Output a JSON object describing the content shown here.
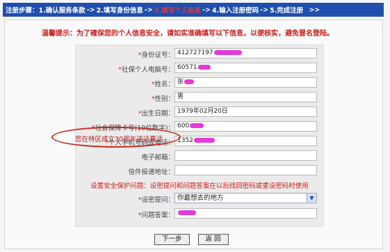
{
  "steps": {
    "intro": "注册步骤：",
    "s1": "1.确认服务条款",
    "s2": "2.填写身份信息",
    "s3": "3.填写个人信息",
    "s4": "4.输入注册密码",
    "s5": "5.完成注册",
    "arrow": "->",
    "tail": ">>"
  },
  "warning": "温馨提示：为了確保您的个人信息安全，请如实准确填写以下信息，以便核实，避免冒名登陆。",
  "form": {
    "fields": [
      {
        "label": "身份证号：",
        "value": "412727197"
      },
      {
        "label": "社保个人电脑号：",
        "value": "60571"
      },
      {
        "label": "姓名：",
        "value": "张"
      },
      {
        "label": "性别：",
        "value": "男"
      },
      {
        "label": "出生日期：",
        "value": "1979年02月20日"
      },
      {
        "label": "社会保障卡号(10位数字)：",
        "value": "600"
      },
      {
        "label": "个人手机号码或电话：",
        "value": "1352"
      },
      {
        "label": "电子邮箱：",
        "value": ""
      },
      {
        "label": "信件投递地址：",
        "value": ""
      }
    ],
    "security_notice": "设置安全保护问题：设密提问和问题答案在以后找回密码或重设密码时使用",
    "question_label": "设密提问：",
    "question_value": "你最想去的地方",
    "answer_label": "问题答案：",
    "answer_value": ""
  },
  "annotation": "您在特区成立30周年送话费活",
  "buttons": {
    "next": "下一步",
    "back": "返 回"
  },
  "colors": {
    "step_bar": "#1f4fae",
    "current_step": "#e03a3a",
    "warning": "#d21a1a",
    "redaction": "#e33ad9",
    "annotation_ellipse": "#c8281e"
  }
}
